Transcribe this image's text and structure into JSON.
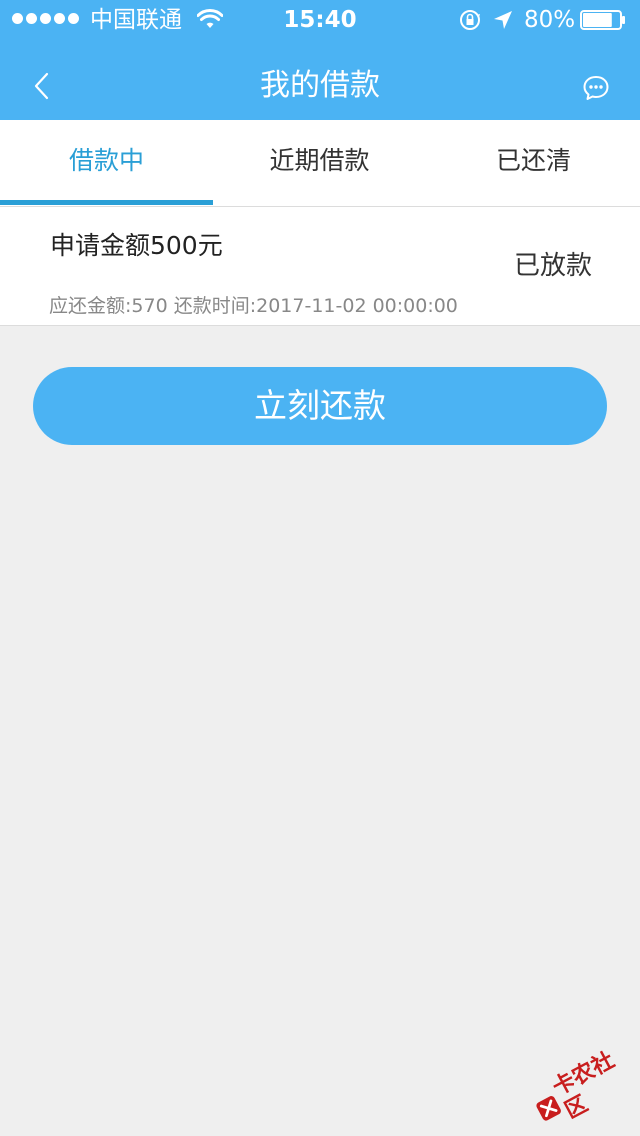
{
  "status_bar": {
    "carrier": "中国联通",
    "time": "15:40",
    "battery_percent": "80%",
    "battery_level": 0.8,
    "icons": [
      "signal-dots-icon",
      "wifi-icon",
      "rotation-lock-icon",
      "location-arrow-icon",
      "battery-icon"
    ]
  },
  "nav": {
    "title": "我的借款",
    "back_icon": "chevron-left-icon",
    "chat_icon": "chat-bubble-icon"
  },
  "tabs": [
    {
      "label": "借款中",
      "active": true
    },
    {
      "label": "近期借款",
      "active": false
    },
    {
      "label": "已还清",
      "active": false
    }
  ],
  "loan": {
    "amount_text": "申请金额500元",
    "status": "已放款",
    "detail": "应还金额:570 还款时间:2017-11-02 00:00:00"
  },
  "actions": {
    "repay_label": "立刻还款"
  },
  "watermark": {
    "text": "卡农社区"
  },
  "colors": {
    "primary": "#4bb3f3",
    "tab_active": "#2a9fd6",
    "background": "#efefef"
  }
}
